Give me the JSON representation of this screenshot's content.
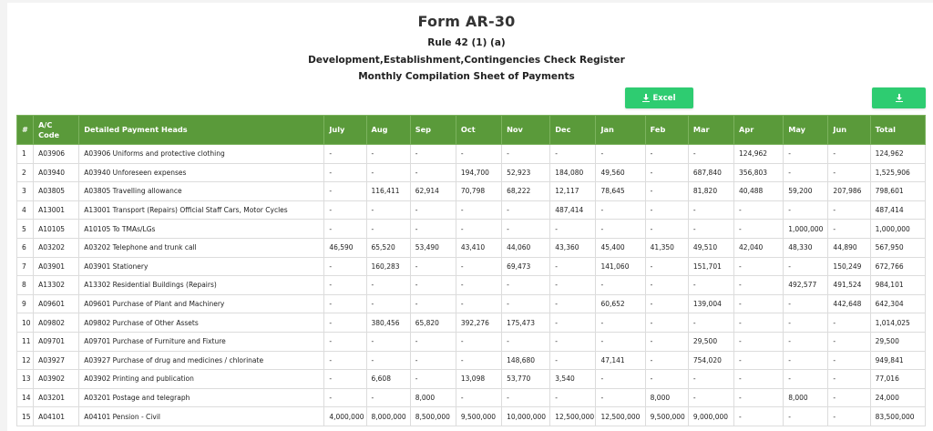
{
  "header": {
    "title": "Form AR-30",
    "rule": "Rule 42 (1) (a)",
    "register": "Development,Establishment,Contingencies Check Register",
    "sheet": "Monthly Compilation Sheet of Payments"
  },
  "toolbar": {
    "excel_label": "Excel",
    "excel_icon": "download-icon",
    "download_icon": "download-icon",
    "accent": "#2ecc71"
  },
  "table": {
    "header_color": "#5a9a3a",
    "columns": [
      "#",
      "A/C Code",
      "Detailed Payment Heads",
      "July",
      "Aug",
      "Sep",
      "Oct",
      "Nov",
      "Dec",
      "Jan",
      "Feb",
      "Mar",
      "Apr",
      "May",
      "Jun",
      "Total"
    ],
    "rows": [
      [
        "1",
        "A03906",
        "A03906 Uniforms and protective clothing",
        "-",
        "-",
        "-",
        "-",
        "-",
        "-",
        "-",
        "-",
        "-",
        "124,962",
        "-",
        "-",
        "124,962"
      ],
      [
        "2",
        "A03940",
        "A03940 Unforeseen expenses",
        "-",
        "-",
        "-",
        "194,700",
        "52,923",
        "184,080",
        "49,560",
        "-",
        "687,840",
        "356,803",
        "-",
        "-",
        "1,525,906"
      ],
      [
        "3",
        "A03805",
        "A03805 Travelling allowance",
        "-",
        "116,411",
        "62,914",
        "70,798",
        "68,222",
        "12,117",
        "78,645",
        "-",
        "81,820",
        "40,488",
        "59,200",
        "207,986",
        "798,601"
      ],
      [
        "4",
        "A13001",
        "A13001 Transport (Repairs) Official Staff Cars, Motor Cycles",
        "-",
        "-",
        "-",
        "-",
        "-",
        "487,414",
        "-",
        "-",
        "-",
        "-",
        "-",
        "-",
        "487,414"
      ],
      [
        "5",
        "A10105",
        "A10105 To TMAs/LGs",
        "-",
        "-",
        "-",
        "-",
        "-",
        "-",
        "-",
        "-",
        "-",
        "-",
        "1,000,000",
        "-",
        "1,000,000"
      ],
      [
        "6",
        "A03202",
        "A03202 Telephone and trunk call",
        "46,590",
        "65,520",
        "53,490",
        "43,410",
        "44,060",
        "43,360",
        "45,400",
        "41,350",
        "49,510",
        "42,040",
        "48,330",
        "44,890",
        "567,950"
      ],
      [
        "7",
        "A03901",
        "A03901 Stationery",
        "-",
        "160,283",
        "-",
        "-",
        "69,473",
        "-",
        "141,060",
        "-",
        "151,701",
        "-",
        "-",
        "150,249",
        "672,766"
      ],
      [
        "8",
        "A13302",
        "A13302 Residential Buildings (Repairs)",
        "-",
        "-",
        "-",
        "-",
        "-",
        "-",
        "-",
        "-",
        "-",
        "-",
        "492,577",
        "491,524",
        "984,101"
      ],
      [
        "9",
        "A09601",
        "A09601 Purchase of Plant and Machinery",
        "-",
        "-",
        "-",
        "-",
        "-",
        "-",
        "60,652",
        "-",
        "139,004",
        "-",
        "-",
        "442,648",
        "642,304"
      ],
      [
        "10",
        "A09802",
        "A09802 Purchase of Other Assets",
        "-",
        "380,456",
        "65,820",
        "392,276",
        "175,473",
        "-",
        "-",
        "-",
        "-",
        "-",
        "-",
        "-",
        "1,014,025"
      ],
      [
        "11",
        "A09701",
        "A09701 Purchase of Furniture and Fixture",
        "-",
        "-",
        "-",
        "-",
        "-",
        "-",
        "-",
        "-",
        "29,500",
        "-",
        "-",
        "-",
        "29,500"
      ],
      [
        "12",
        "A03927",
        "A03927 Purchase of drug and medicines / chlorinate",
        "-",
        "-",
        "-",
        "-",
        "148,680",
        "-",
        "47,141",
        "-",
        "754,020",
        "-",
        "-",
        "-",
        "949,841"
      ],
      [
        "13",
        "A03902",
        "A03902 Printing and publication",
        "-",
        "6,608",
        "-",
        "13,098",
        "53,770",
        "3,540",
        "-",
        "-",
        "-",
        "-",
        "-",
        "-",
        "77,016"
      ],
      [
        "14",
        "A03201",
        "A03201 Postage and telegraph",
        "-",
        "-",
        "8,000",
        "-",
        "-",
        "-",
        "-",
        "8,000",
        "-",
        "-",
        "8,000",
        "-",
        "24,000"
      ],
      [
        "15",
        "A04101",
        "A04101 Pension - Civil",
        "4,000,000",
        "8,000,000",
        "8,500,000",
        "9,500,000",
        "10,000,000",
        "12,500,000",
        "12,500,000",
        "9,500,000",
        "9,000,000",
        "-",
        "-",
        "-",
        "83,500,000"
      ]
    ]
  }
}
